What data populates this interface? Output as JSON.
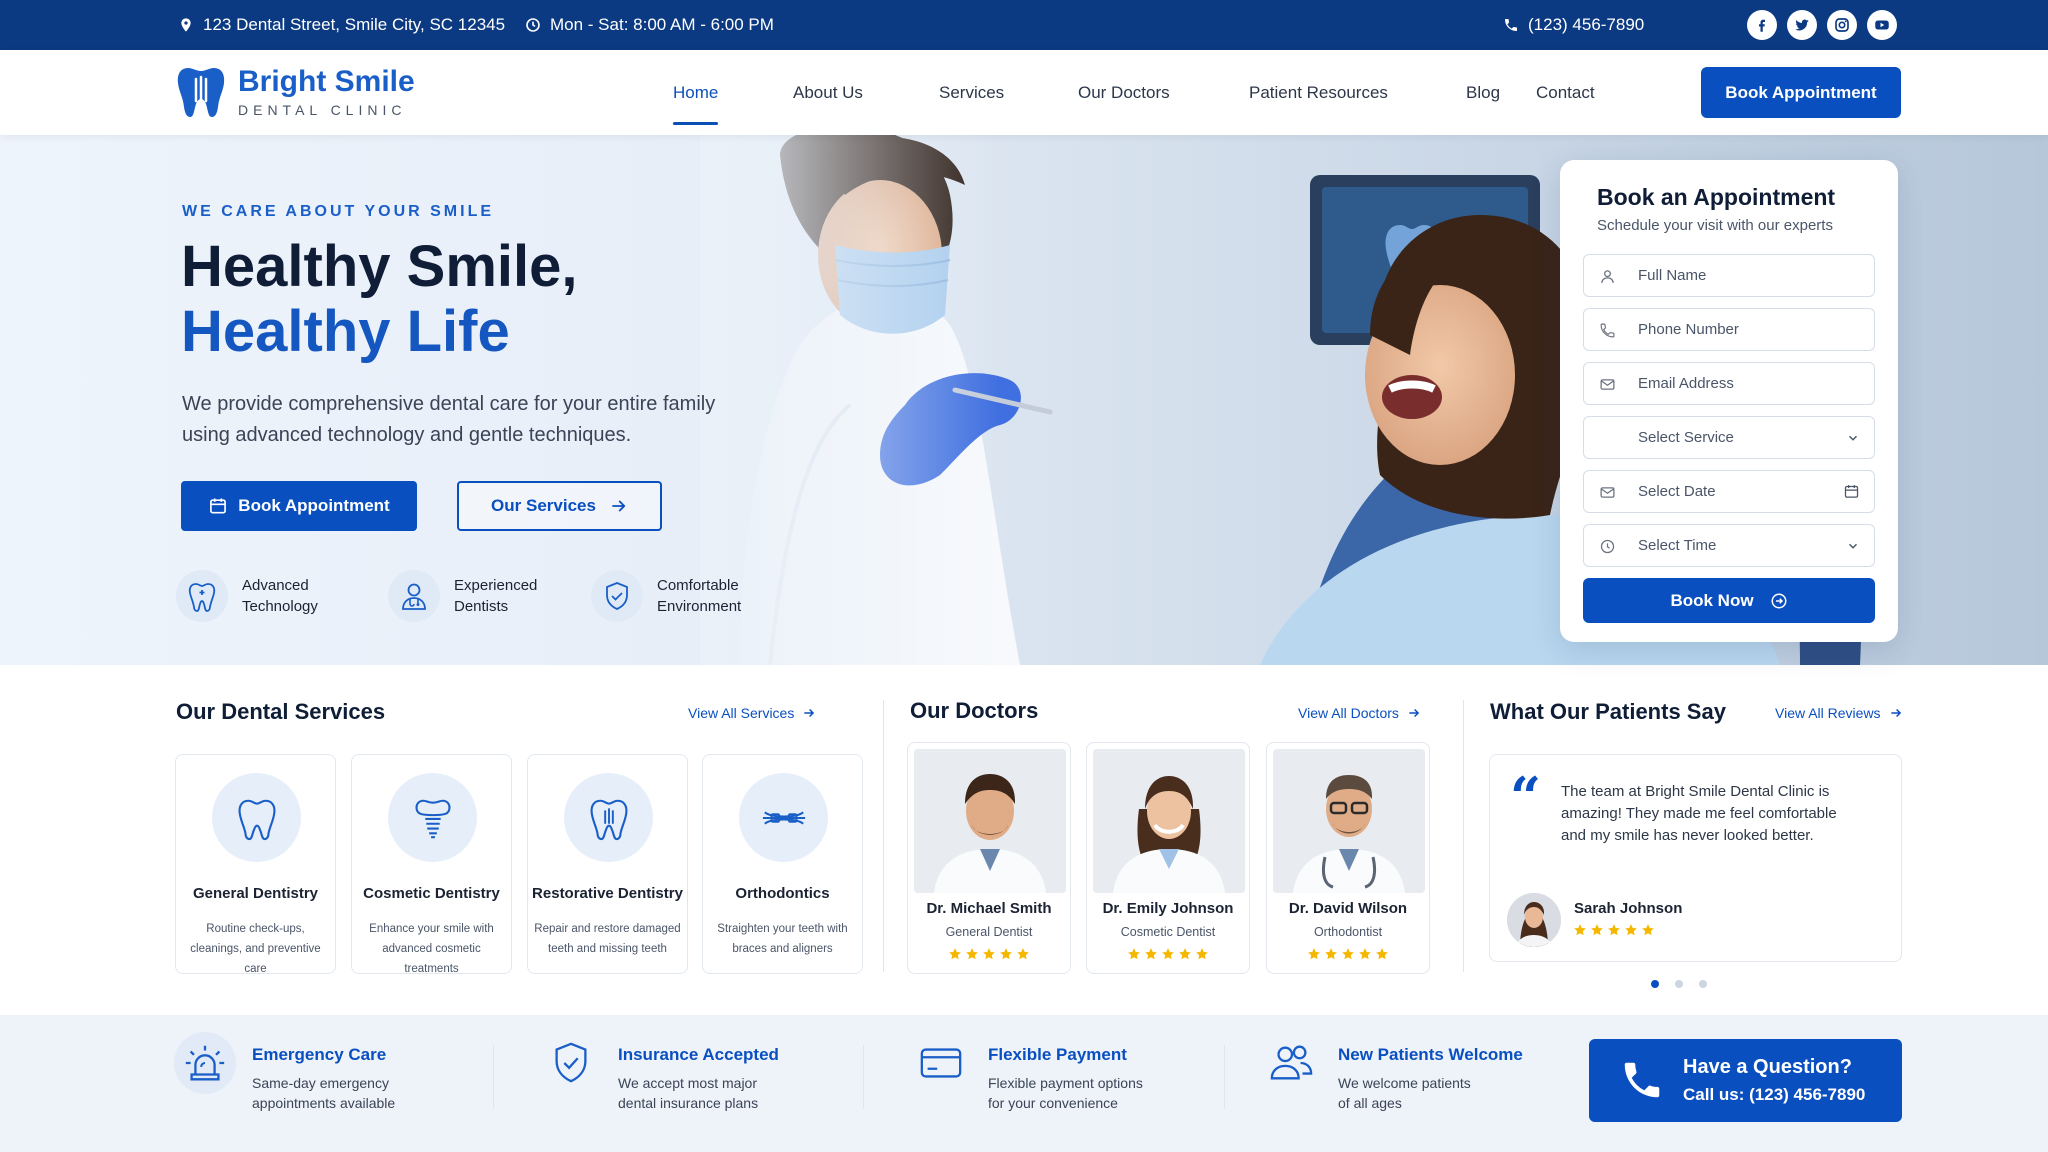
{
  "topbar": {
    "address": "123 Dental Street, Smile City, SC 12345",
    "hours": "Mon - Sat: 8:00 AM - 6:00 PM",
    "phone": "(123) 456-7890",
    "social": [
      "facebook-icon",
      "twitter-icon",
      "instagram-icon",
      "youtube-icon"
    ]
  },
  "brand": {
    "name": "Bright Smile",
    "tagline": "DENTAL CLINIC",
    "color": "#1a5fc8"
  },
  "nav": {
    "items": [
      "Home",
      "About Us",
      "Services",
      "Our Doctors",
      "Patient Resources",
      "Blog",
      "Contact"
    ],
    "active": "Home",
    "cta": "Book Appointment"
  },
  "hero": {
    "kicker": "WE CARE ABOUT YOUR SMILE",
    "title_line1": "Healthy Smile,",
    "title_line2": "Healthy Life",
    "lead": "We provide comprehensive dental care for your entire family using advanced technology and gentle techniques.",
    "primary_button": "Book Appointment",
    "secondary_button": "Our Services",
    "features": [
      {
        "icon": "tooth-sparkle-icon",
        "label": "Advanced Technology"
      },
      {
        "icon": "dentist-icon",
        "label": "Experienced Dentists"
      },
      {
        "icon": "shield-check-icon",
        "label": "Comfortable Environment"
      }
    ]
  },
  "booking": {
    "title": "Book an Appointment",
    "subtitle": "Schedule your visit with our experts",
    "full_name": "Full Name",
    "phone": "Phone Number",
    "email": "Email Address",
    "service": "Select Service",
    "date": "Select Date",
    "time": "Select Time",
    "submit": "Book Now"
  },
  "services": {
    "title": "Our Dental Services",
    "link": "View All Services",
    "items": [
      {
        "name": "General Dentistry",
        "desc": "Routine check-ups, cleanings, and preventive care",
        "icon": "tooth-icon"
      },
      {
        "name": "Cosmetic Dentistry",
        "desc": "Enhance your smile with advanced cosmetic treatments",
        "icon": "implant-icon"
      },
      {
        "name": "Restorative Dentistry",
        "desc": "Repair and restore damaged teeth and missing teeth",
        "icon": "restored-tooth-icon"
      },
      {
        "name": "Orthodontics",
        "desc": "Straighten your teeth with braces and aligners",
        "icon": "braces-icon"
      }
    ]
  },
  "doctors": {
    "title": "Our Doctors",
    "link": "View All Doctors",
    "items": [
      {
        "name": "Dr. Michael Smith",
        "role": "General Dentist",
        "rating": 5
      },
      {
        "name": "Dr. Emily Johnson",
        "role": "Cosmetic Dentist",
        "rating": 5
      },
      {
        "name": "Dr. David Wilson",
        "role": "Orthodontist",
        "rating": 5
      }
    ]
  },
  "testimonials": {
    "title": "What Our Patients Say",
    "link": "View All Reviews",
    "quote": "The team at Bright Smile Dental Clinic is amazing! They made me feel comfortable and my smile has never looked better.",
    "author": "Sarah Johnson",
    "rating": 5,
    "pages": 3,
    "current_page": 1
  },
  "highlights": [
    {
      "title": "Emergency Care",
      "line1": "Same-day emergency",
      "line2": "appointments available",
      "icon": "siren-icon"
    },
    {
      "title": "Insurance Accepted",
      "line1": "We accept most major",
      "line2": "dental insurance plans",
      "icon": "shield-check-icon"
    },
    {
      "title": "Flexible Payment",
      "line1": "Flexible payment options",
      "line2": "for your convenience",
      "icon": "credit-card-icon"
    },
    {
      "title": "New Patients Welcome",
      "line1": "We welcome patients",
      "line2": "of all ages",
      "icon": "users-icon"
    }
  ],
  "question": {
    "title": "Have a Question?",
    "phone": "Call us: (123) 456-7890"
  },
  "colors": {
    "primary": "#0a4fc0",
    "topbar": "#0b3a82",
    "star": "#f5b800",
    "text": "#0f1d36"
  }
}
